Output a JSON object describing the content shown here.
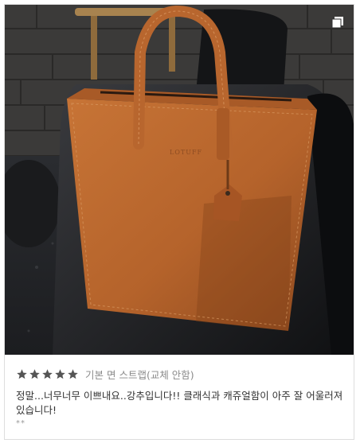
{
  "review": {
    "rating": 5,
    "rating_max": 5,
    "option_text": "기본 면 스트랩(교체 안함)",
    "body": "정말...너무너무 이쁘내요..강추입니다!! 클래식과 캐쥬얼함이 아주 잘 어울러져 있습니다!",
    "footnote": "**"
  },
  "photo": {
    "bag_brand_text": "LOTUFF",
    "icon": "multiple-images-icon"
  },
  "colors": {
    "star": "#555555",
    "bag": "#b8662e",
    "border": "#dddddd"
  }
}
